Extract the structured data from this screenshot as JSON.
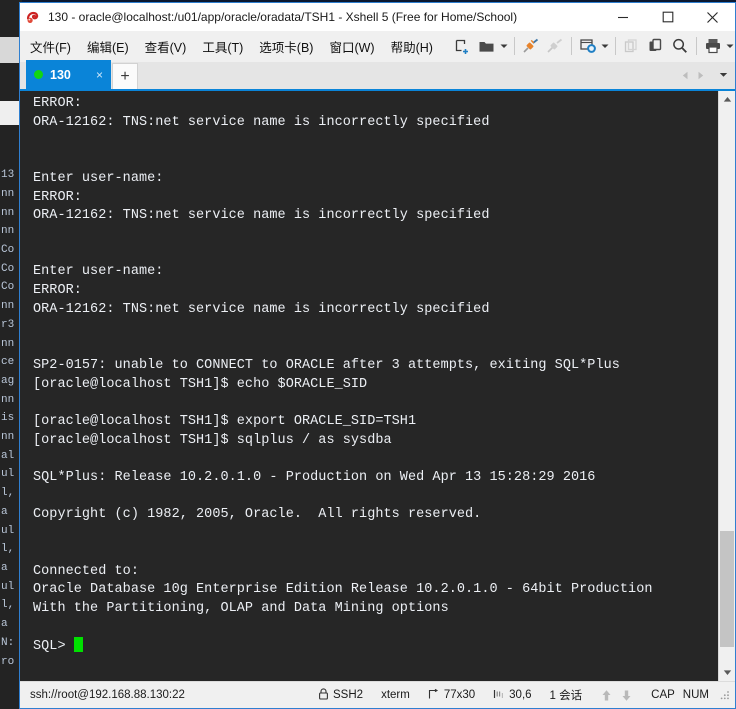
{
  "window": {
    "title": "130 - oracle@localhost:/u01/app/oracle/oradata/TSH1 - Xshell 5 (Free for Home/School)",
    "app_icon": "xshell-logo-icon",
    "minimize_label": "—",
    "maximize_label": "□",
    "close_label": "✕",
    "border_color": "#2f7fd0"
  },
  "menu": {
    "items": [
      {
        "label": "文件(F)",
        "name": "menu-file"
      },
      {
        "label": "编辑(E)",
        "name": "menu-edit"
      },
      {
        "label": "查看(V)",
        "name": "menu-view"
      },
      {
        "label": "工具(T)",
        "name": "menu-tools"
      },
      {
        "label": "选项卡(B)",
        "name": "menu-tabs"
      },
      {
        "label": "窗口(W)",
        "name": "menu-window"
      },
      {
        "label": "帮助(H)",
        "name": "menu-help"
      }
    ]
  },
  "toolbar": {
    "buttons": [
      "new-session-icon",
      "open-session-folder-icon",
      "connect-plug-icon",
      "disconnect-plug-icon",
      "session-properties-gear-icon",
      "copy-icon",
      "paste-icon",
      "find-search-icon",
      "print-icon"
    ],
    "overflow_label": "»"
  },
  "tabs": {
    "active": {
      "label": "130",
      "status": "connected",
      "status_color": "#12d612",
      "close_label": "×"
    },
    "new_tab_label": "+",
    "nav_prev_label": "◀",
    "nav_next_label": "▶",
    "nav_list_label": "▼"
  },
  "terminal": {
    "background": "#262626",
    "foreground": "#eceff4",
    "cursor_color": "#00e000",
    "lines": [
      "ERROR:",
      "ORA-12162: TNS:net service name is incorrectly specified",
      "",
      "",
      "Enter user-name:",
      "ERROR:",
      "ORA-12162: TNS:net service name is incorrectly specified",
      "",
      "",
      "Enter user-name:",
      "ERROR:",
      "ORA-12162: TNS:net service name is incorrectly specified",
      "",
      "",
      "SP2-0157: unable to CONNECT to ORACLE after 3 attempts, exiting SQL*Plus",
      "[oracle@localhost TSH1]$ echo $ORACLE_SID",
      "",
      "[oracle@localhost TSH1]$ export ORACLE_SID=TSH1",
      "[oracle@localhost TSH1]$ sqlplus / as sysdba",
      "",
      "SQL*Plus: Release 10.2.0.1.0 - Production on Wed Apr 13 15:28:29 2016",
      "",
      "Copyright (c) 1982, 2005, Oracle.  All rights reserved.",
      "",
      "",
      "Connected to:",
      "Oracle Database 10g Enterprise Edition Release 10.2.0.1.0 - 64bit Production",
      "With the Partitioning, OLAP and Data Mining options",
      ""
    ],
    "prompt": "SQL> "
  },
  "scrollbar": {
    "up_label": "▲",
    "down_label": "▼"
  },
  "status_bar": {
    "url": "ssh://root@192.168.88.130:22",
    "lock_icon": "padlock-icon",
    "protocol": "SSH2",
    "terminal_type": "xterm",
    "size_icon": "terminal-size-icon",
    "size": "77x30",
    "cursor_icon": "cursor-position-icon",
    "cursor_position": "30,6",
    "sessions": "1 会话",
    "upload_icon": "upload-arrow-icon",
    "download_icon": "download-arrow-icon",
    "caps_lock": "CAP",
    "num_lock": "NUM",
    "resize_grip": "resize-grip-icon"
  },
  "background_window": {
    "strip_text": "13\nnn\nnn\nnn\nCo\nCo\nCo\nnn\nr3\nnn\nce\nag\nnn\nis\nnn\nal\nul\nl,\na\nul\nl,\na\nul\nl,\na\nN:\nro"
  }
}
